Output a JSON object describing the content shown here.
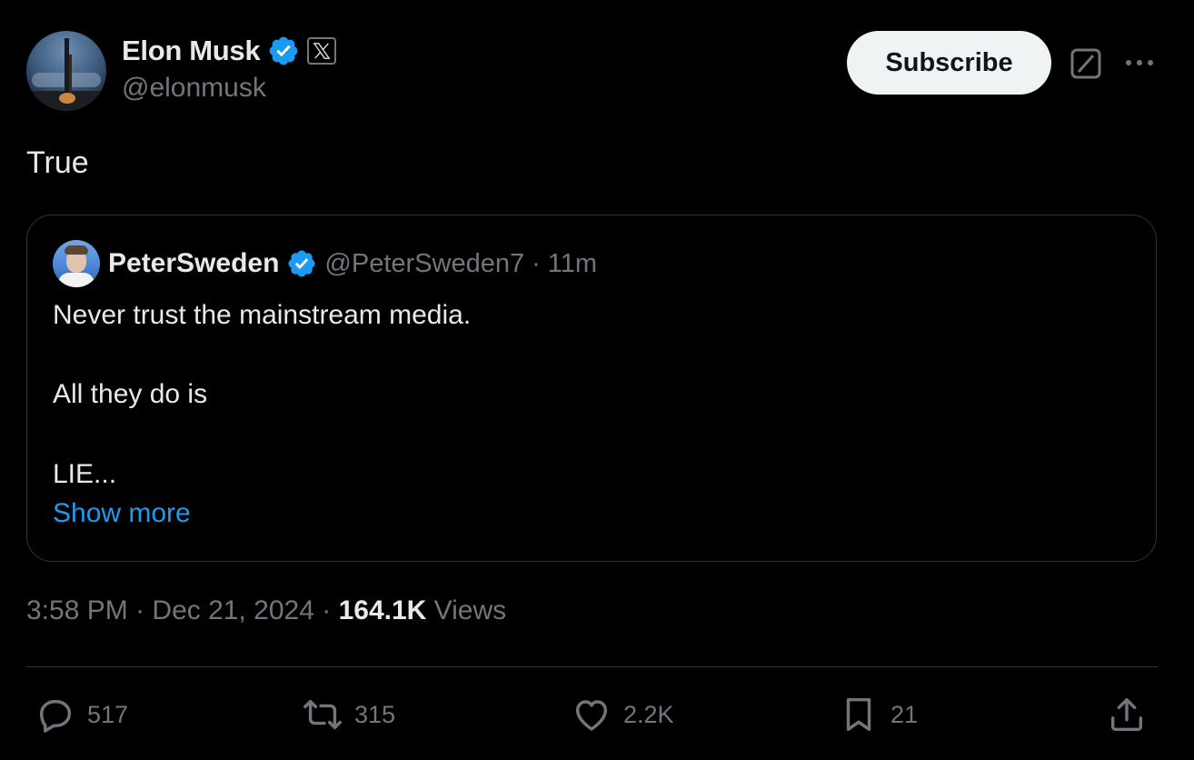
{
  "author": {
    "display_name": "Elon Musk",
    "handle": "@elonmusk",
    "verified_badge_icon": "verified-badge-icon",
    "affiliate_icon": "x-logo-icon"
  },
  "header": {
    "subscribe_label": "Subscribe"
  },
  "tweet": {
    "text": "True"
  },
  "quote": {
    "display_name": "PeterSweden",
    "handle": "@PeterSweden7",
    "separator": "·",
    "time_ago": "11m",
    "lines": [
      "Never trust the mainstream media.",
      "All they do is",
      "LIE..."
    ],
    "show_more_label": "Show more"
  },
  "meta": {
    "time": "3:58 PM",
    "sep1": "·",
    "date": "Dec 21, 2024",
    "sep2": "·",
    "views_count": "164.1K",
    "views_label": "Views"
  },
  "actions": {
    "replies": "517",
    "reposts": "315",
    "likes": "2.2K",
    "bookmarks": "21"
  },
  "colors": {
    "background": "#000000",
    "text_primary": "#e7e9ea",
    "text_secondary": "#71767b",
    "accent": "#1d9bf0",
    "border": "#2f3336"
  }
}
